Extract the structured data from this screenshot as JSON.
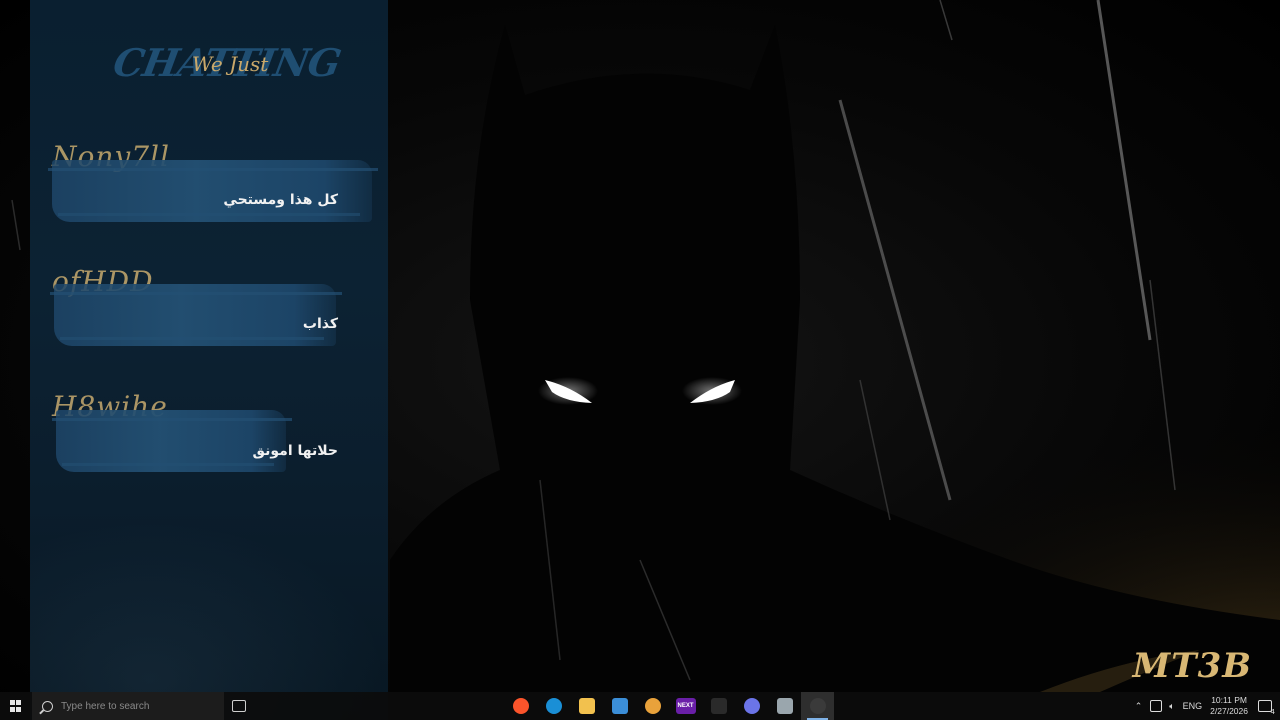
{
  "panel": {
    "title_bg": "CHATTING",
    "title_fg": "We Just",
    "messages": [
      {
        "user": "Nony7ll",
        "text": "كل هذا ومستحي"
      },
      {
        "user": "ofHDD",
        "text": "كذاب"
      },
      {
        "user": "H8wihe",
        "text": "حلاتها امونق"
      }
    ]
  },
  "signature": "MT3B",
  "taskbar": {
    "search_placeholder": "Type here to search",
    "apps": [
      {
        "name": "brave",
        "icon": "brave-icon",
        "color": "#fb542b",
        "label": ""
      },
      {
        "name": "edge",
        "icon": "edge-icon",
        "color": "#1a8fd6",
        "label": ""
      },
      {
        "name": "file-explorer",
        "icon": "folder-icon",
        "color": "#f2c14e",
        "label": ""
      },
      {
        "name": "app-blue",
        "icon": "window-app-icon",
        "color": "#3b8ed8",
        "label": ""
      },
      {
        "name": "chrome",
        "icon": "chrome-icon",
        "color": "#e9a23b",
        "label": ""
      },
      {
        "name": "next",
        "icon": "next-app-icon",
        "color": "#6a1fa8",
        "label": "NEXT"
      },
      {
        "name": "xbox",
        "icon": "xbox-icon",
        "color": "#2a2a2a",
        "label": ""
      },
      {
        "name": "discord",
        "icon": "discord-icon",
        "color": "#6b74e8",
        "label": ""
      },
      {
        "name": "app-gray",
        "icon": "panel-app-icon",
        "color": "#9aa6ad",
        "label": ""
      },
      {
        "name": "obs",
        "icon": "obs-icon",
        "color": "#3a3a3a",
        "label": ""
      }
    ],
    "tray": {
      "language": "ENG",
      "time": "10:11 PM",
      "date": "2/27/2026",
      "notification_count": "4"
    }
  }
}
